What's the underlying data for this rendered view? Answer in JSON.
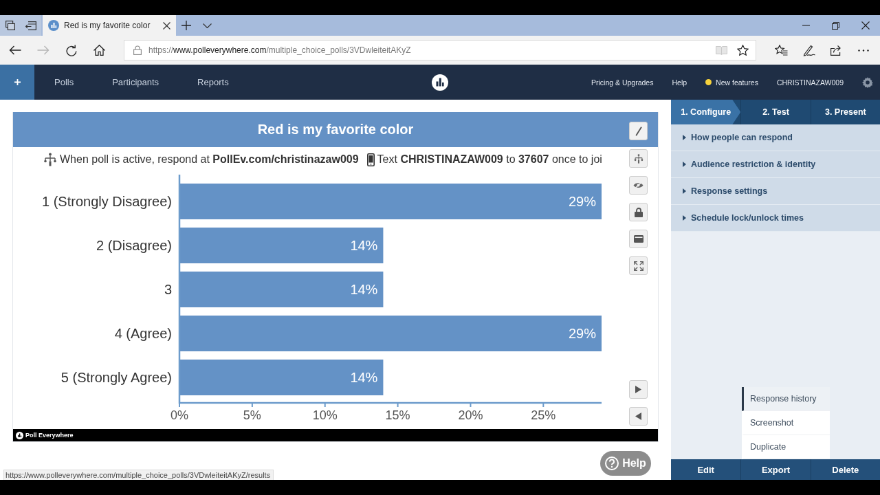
{
  "browser": {
    "tab_title": "Red is my favorite color",
    "nav_buttons": [
      {
        "kind": "back",
        "disabled": false
      },
      {
        "kind": "forward",
        "disabled": true
      },
      {
        "kind": "refresh",
        "disabled": false
      },
      {
        "kind": "home",
        "disabled": false
      }
    ],
    "url": {
      "scheme": "https://",
      "host": "www.polleverywhere.com",
      "path": "/multiple_choice_polls/3VDwleiteitAKyZ"
    }
  },
  "app_nav": {
    "links": [
      "Polls",
      "Participants",
      "Reports"
    ],
    "right_links": [
      "Pricing & Upgrades",
      "Help"
    ],
    "new_features": "New features",
    "user": "CHRISTINAZAW009"
  },
  "poll": {
    "title": "Red is my favorite color",
    "web_instruction": "When poll is active, respond at **PollEv.com/christinazaw009**",
    "text_instruction": "Text **CHRISTINAZAW009** to **37607** once to joi",
    "chart_data": [
      {
        "type": "bar",
        "orientation": "horizontal",
        "categories": [
          "1 (Strongly Disagree)",
          "2 (Disagree)",
          "3",
          "4 (Agree)",
          "5 (Strongly Agree)"
        ],
        "values": [
          29,
          14,
          14,
          29,
          14
        ],
        "value_labels": [
          "29%",
          "14%",
          "14%",
          "29%",
          "14%"
        ],
        "color": "#6492c6",
        "xlim": [
          0,
          29
        ],
        "xticks": [
          {
            "value": 0,
            "label": "0%"
          },
          {
            "value": 5,
            "label": "5%"
          },
          {
            "value": 10,
            "label": "10%"
          },
          {
            "value": 15,
            "label": "15%"
          },
          {
            "value": 20,
            "label": "20%"
          },
          {
            "value": 25,
            "label": "25%"
          }
        ]
      }
    ],
    "footer_brand": "Poll Everywhere"
  },
  "help_button": "Help",
  "status_bar": {
    "url": "https://www.polleverywhere.com/multiple_choice_polls/3VDwleiteitAKyZ/results"
  },
  "steps": [
    {
      "label": "1. Configure",
      "selected": true
    },
    {
      "label": "2. Test",
      "selected": false
    },
    {
      "label": "3. Present",
      "selected": false
    }
  ],
  "settings_sections": [
    {
      "label": "How people can respond",
      "expanded": false
    },
    {
      "label": "Audience restriction & identity",
      "expanded": false
    },
    {
      "label": "Response settings",
      "expanded": false
    },
    {
      "label": "Schedule lock/unlock times",
      "expanded": false
    }
  ],
  "export_menu": {
    "items": [
      {
        "label": "Response history",
        "selected": true
      },
      {
        "label": "Screenshot",
        "selected": false
      },
      {
        "label": "Duplicate",
        "selected": false
      }
    ]
  },
  "actions": [
    "Edit",
    "Export",
    "Delete"
  ]
}
